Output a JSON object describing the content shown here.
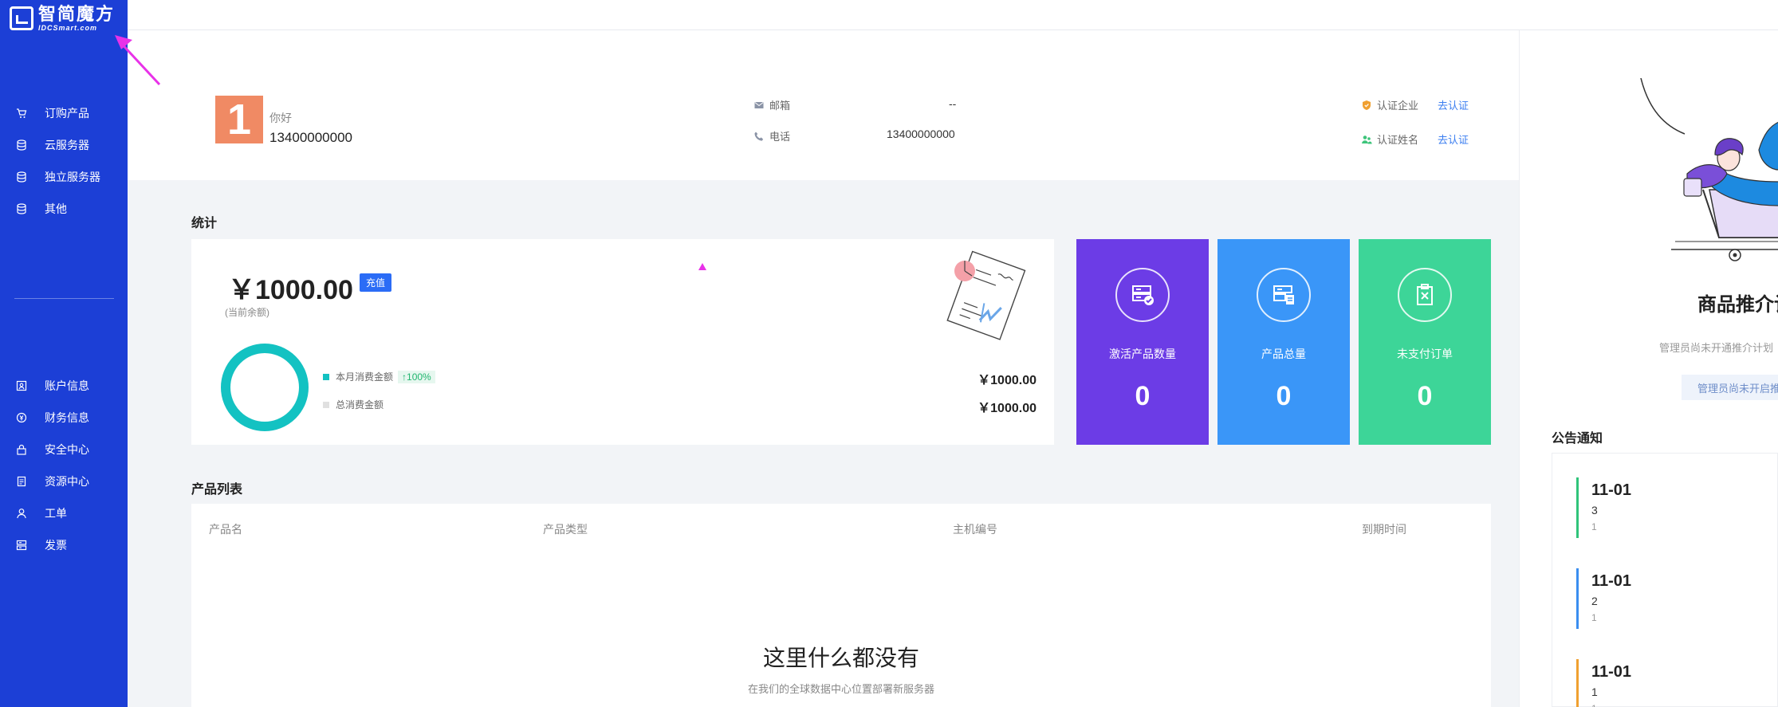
{
  "app": {
    "brand_cn": "智简魔方",
    "brand_en": "IDCSmart.com"
  },
  "sidebar": {
    "menu_top": [
      {
        "label": "订购产品",
        "icon": "cart-icon"
      },
      {
        "label": "云服务器",
        "icon": "database-icon"
      },
      {
        "label": "独立服务器",
        "icon": "database-icon"
      },
      {
        "label": "其他",
        "icon": "database-icon"
      }
    ],
    "menu_bottom": [
      {
        "label": "账户信息",
        "icon": "id-card-icon"
      },
      {
        "label": "财务信息",
        "icon": "money-icon"
      },
      {
        "label": "安全中心",
        "icon": "lock-icon"
      },
      {
        "label": "资源中心",
        "icon": "document-icon"
      },
      {
        "label": "工单",
        "icon": "user-icon"
      },
      {
        "label": "发票",
        "icon": "invoice-icon"
      }
    ]
  },
  "profile": {
    "avatar_text": "1",
    "greeting": "你好",
    "phone_display": "13400000000",
    "email_label": "邮箱",
    "email_value": "--",
    "phone_label": "电话",
    "phone_value": "13400000000",
    "cert_company_label": "认证企业",
    "cert_company_link": "去认证",
    "cert_name_label": "认证姓名",
    "cert_name_link": "去认证"
  },
  "stats": {
    "title": "统计",
    "balance": "￥1000.00",
    "recharge_label": "充值",
    "balance_label": "(当前余额)",
    "month_spend_label": "本月消费金额",
    "month_spend_pct": "↑100%",
    "month_spend_value": "￥1000.00",
    "total_spend_label": "总消费金额",
    "total_spend_value": "￥1000.00",
    "donut_fraction": 1.0,
    "colors": {
      "donut": "#13c2c2",
      "legend_month": "#13c2c2",
      "legend_total": "#e0e0e0"
    }
  },
  "tiles": [
    {
      "label": "激活产品数量",
      "value": "0",
      "color": "#6c3ce6",
      "icon": "server-check-icon"
    },
    {
      "label": "产品总量",
      "value": "0",
      "color": "#3a96f8",
      "icon": "server-list-icon"
    },
    {
      "label": "未支付订单",
      "value": "0",
      "color": "#3dd598",
      "icon": "clipboard-x-icon"
    }
  ],
  "products": {
    "title": "产品列表",
    "columns": [
      "产品名",
      "产品类型",
      "主机编号",
      "到期时间"
    ],
    "empty_title": "这里什么都没有",
    "empty_sub": "在我们的全球数据中心位置部署新服务器"
  },
  "promo": {
    "title": "商品推介计",
    "subtitle": "管理员尚未开通推介计划",
    "button": "管理员尚未开启推"
  },
  "notices": {
    "title": "公告通知",
    "items": [
      {
        "date": "11-01",
        "text": "3",
        "sub": "1",
        "color": "#2fc47a"
      },
      {
        "date": "11-01",
        "text": "2",
        "sub": "1",
        "color": "#3a8ef0"
      },
      {
        "date": "11-01",
        "text": "1",
        "sub": "1",
        "color": "#f0a030"
      }
    ]
  }
}
